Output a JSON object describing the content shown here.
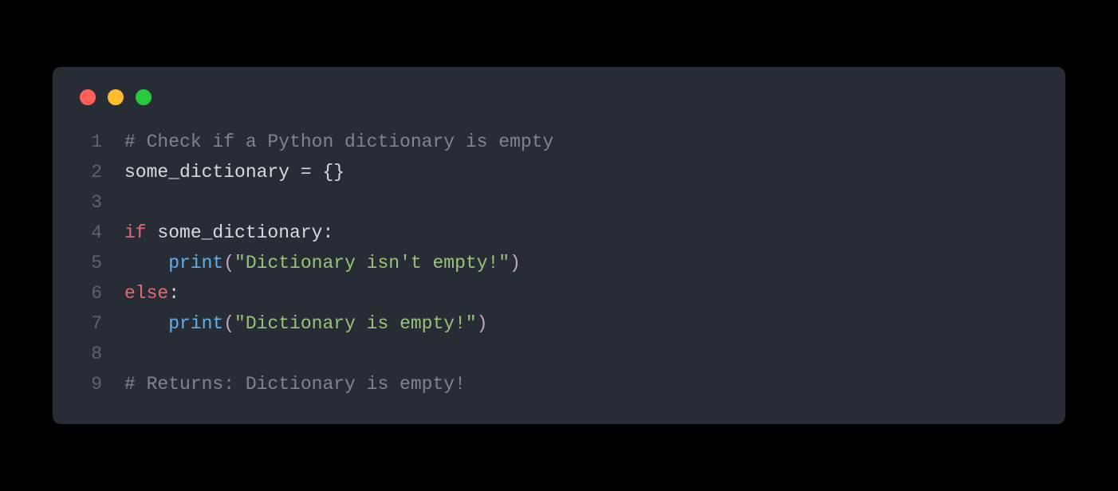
{
  "window": {
    "controls": {
      "red": "close",
      "yellow": "minimize",
      "green": "maximize"
    }
  },
  "code": {
    "lines": [
      {
        "num": "1",
        "tokens": [
          {
            "cls": "tok-comment",
            "t": "# Check if a Python dictionary is empty"
          }
        ]
      },
      {
        "num": "2",
        "tokens": [
          {
            "cls": "tok-default",
            "t": "some_dictionary "
          },
          {
            "cls": "tok-punct",
            "t": "="
          },
          {
            "cls": "tok-default",
            "t": " {}"
          }
        ]
      },
      {
        "num": "3",
        "tokens": []
      },
      {
        "num": "4",
        "tokens": [
          {
            "cls": "tok-keyword",
            "t": "if"
          },
          {
            "cls": "tok-default",
            "t": " some_dictionary:"
          }
        ]
      },
      {
        "num": "5",
        "tokens": [
          {
            "cls": "tok-default",
            "t": "    "
          },
          {
            "cls": "tok-func",
            "t": "print"
          },
          {
            "cls": "tok-paren",
            "t": "("
          },
          {
            "cls": "tok-string",
            "t": "\"Dictionary isn't empty!\""
          },
          {
            "cls": "tok-paren",
            "t": ")"
          }
        ]
      },
      {
        "num": "6",
        "tokens": [
          {
            "cls": "tok-keyword",
            "t": "else"
          },
          {
            "cls": "tok-default",
            "t": ":"
          }
        ]
      },
      {
        "num": "7",
        "tokens": [
          {
            "cls": "tok-default",
            "t": "    "
          },
          {
            "cls": "tok-func",
            "t": "print"
          },
          {
            "cls": "tok-paren",
            "t": "("
          },
          {
            "cls": "tok-string",
            "t": "\"Dictionary is empty!\""
          },
          {
            "cls": "tok-paren",
            "t": ")"
          }
        ]
      },
      {
        "num": "8",
        "tokens": []
      },
      {
        "num": "9",
        "tokens": [
          {
            "cls": "tok-comment",
            "t": "# Returns: Dictionary is empty!"
          }
        ]
      }
    ]
  }
}
